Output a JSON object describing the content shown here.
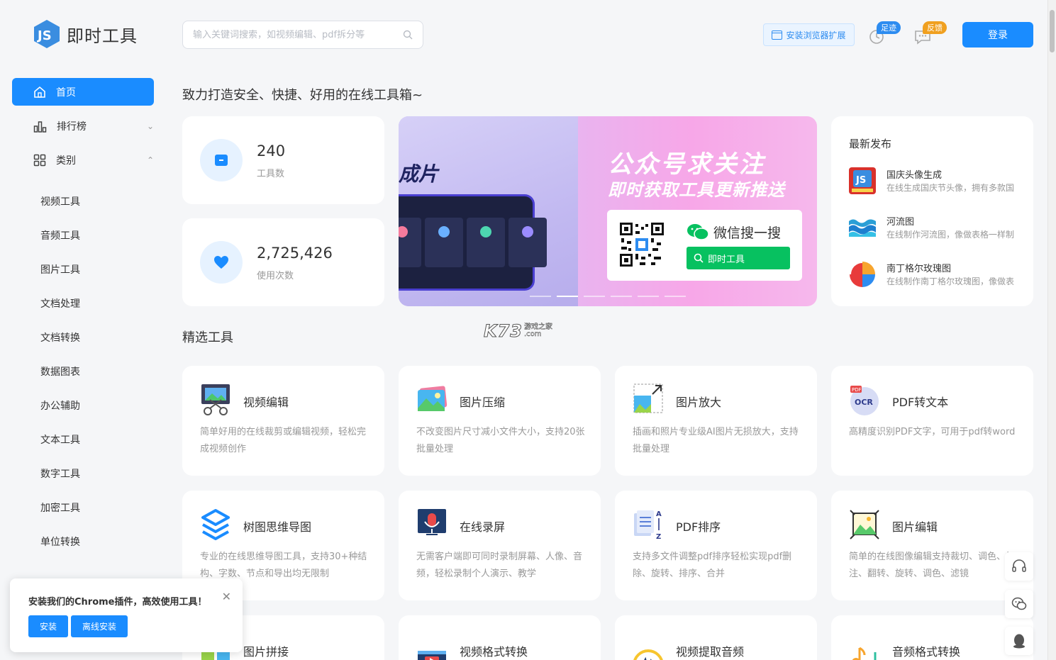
{
  "app": {
    "name": "即时工具"
  },
  "search": {
    "placeholder": "输入关键词搜索，如视频编辑、pdf拆分等"
  },
  "header": {
    "extension_label": "安装浏览器扩展",
    "history_badge": "足迹",
    "feedback_badge": "反馈",
    "login_label": "登录"
  },
  "sidebar": {
    "home": "首页",
    "ranking": "排行榜",
    "categories": "类别",
    "items": [
      "视频工具",
      "音频工具",
      "图片工具",
      "文档处理",
      "文档转换",
      "数据图表",
      "办公辅助",
      "文本工具",
      "数字工具",
      "加密工具",
      "单位转换"
    ]
  },
  "main": {
    "slogan": "致力打造安全、快捷、好用的在线工具箱~",
    "stats": [
      {
        "value": "240",
        "label": "工具数"
      },
      {
        "value": "2,725,426",
        "label": "使用次数"
      }
    ],
    "banner": {
      "fragment": "成片",
      "title": "公众号求关注",
      "subtitle": "即时获取工具更新推送",
      "wechat_search": "微信搜一搜",
      "wechat_button": "即时工具",
      "slide_count": 6,
      "active_slide": 2
    },
    "latest": {
      "title": "最新发布",
      "items": [
        {
          "name": "国庆头像生成",
          "desc": "在线生成国庆节头像，拥有多款国"
        },
        {
          "name": "河流图",
          "desc": "在线制作河流图，像做表格一样制"
        },
        {
          "name": "南丁格尔玫瑰图",
          "desc": "在线制作南丁格尔玫瑰图，像做表"
        }
      ]
    },
    "featured_title": "精选工具",
    "tools": [
      {
        "name": "视频编辑",
        "desc": "简单好用的在线裁剪或编辑视频，轻松完成视频创作",
        "icon": "video-edit-icon"
      },
      {
        "name": "图片压缩",
        "desc": "不改变图片尺寸减小文件大小，支持20张批量处理",
        "icon": "image-compress-icon"
      },
      {
        "name": "图片放大",
        "desc": "插画和照片专业级AI图片无损放大，支持批量处理",
        "icon": "image-upscale-icon"
      },
      {
        "name": "PDF转文本",
        "desc": "高精度识别PDF文字，可用于pdf转word",
        "icon": "pdf-ocr-icon"
      },
      {
        "name": "树图思维导图",
        "desc": "专业的在线思维导图工具，支持30+种结构、字数、节点和导出均无限制",
        "icon": "mindmap-icon"
      },
      {
        "name": "在线录屏",
        "desc": "无需客户端即可同时录制屏幕、人像、音频，轻松录制个人演示、教学",
        "icon": "screen-record-icon"
      },
      {
        "name": "PDF排序",
        "desc": "支持多文件调整pdf排序轻松实现pdf删除、旋转、排序、合并",
        "icon": "pdf-sort-icon"
      },
      {
        "name": "图片编辑",
        "desc": "简单的在线图像编辑支持裁切、调色、标注、翻转、旋转、调色、滤镜",
        "icon": "image-edit-icon"
      },
      {
        "name": "图片拼接",
        "desc": "",
        "icon": "image-stitch-icon"
      },
      {
        "name": "视频格式转换",
        "desc": "",
        "icon": "video-convert-icon"
      },
      {
        "name": "视频提取音频",
        "desc": "",
        "icon": "audio-extract-icon"
      },
      {
        "name": "音频格式转换",
        "desc": "",
        "icon": "audio-convert-icon"
      }
    ]
  },
  "chrome_popup": {
    "text": "安装我们的Chrome插件，高效使用工具！",
    "install": "安装",
    "offline_install": "离线安装"
  },
  "watermark": {
    "text": "K73",
    "sub1": "游戏之家",
    "sub2": ".com"
  },
  "colors": {
    "primary": "#1a8cff",
    "wechat_green": "#07c160",
    "badge_blue": "#2d8cf0",
    "badge_orange": "#f0a020"
  }
}
